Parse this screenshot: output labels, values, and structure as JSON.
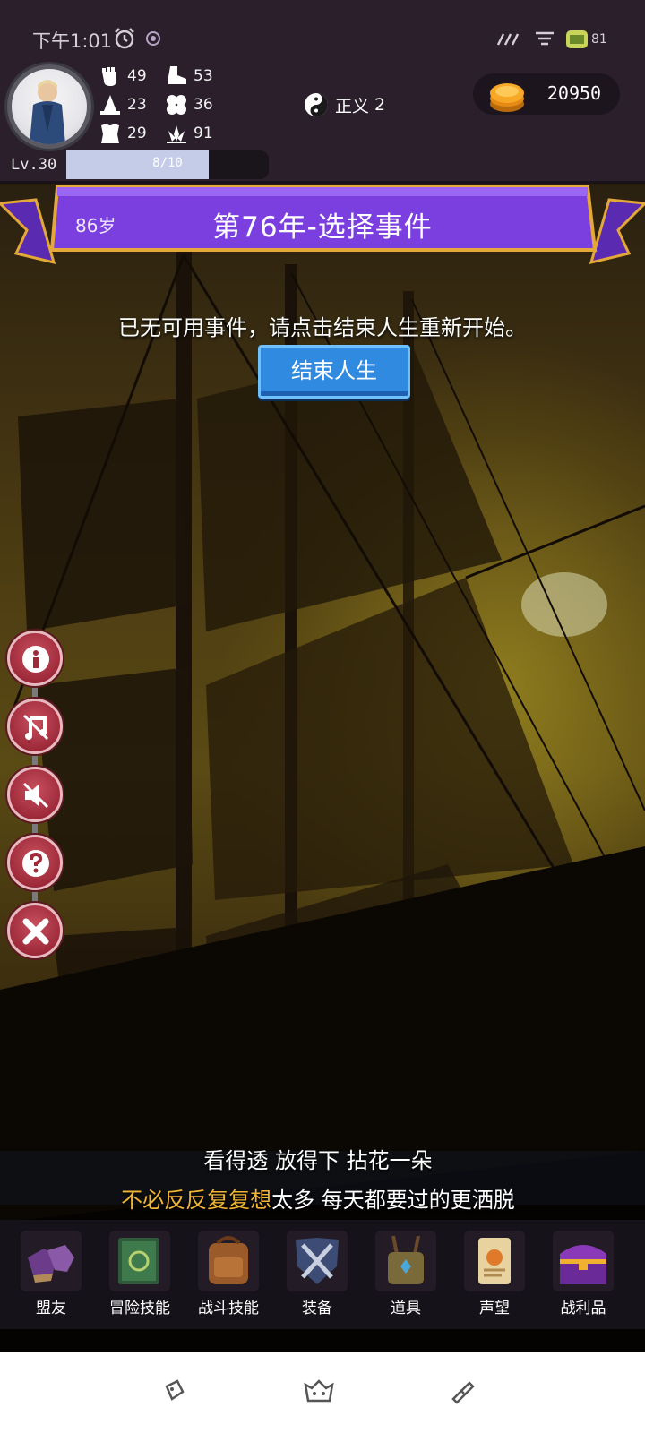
{
  "status_bar": {
    "time": "下午1:01",
    "battery": "81"
  },
  "player": {
    "stats": {
      "strength": "49",
      "agility": "53",
      "magic": "23",
      "luck": "36",
      "defense": "29",
      "spirit": "91"
    },
    "alignment": {
      "label": "正义",
      "value": "2"
    },
    "gold": "20950",
    "level": "Lv.30",
    "xp_text": "8/10",
    "xp_fraction": 0.8
  },
  "ribbon": {
    "age": "86岁",
    "title": "第76年-选择事件"
  },
  "message": "已无可用事件，请点击结束人生重新开始。",
  "end_button": "结束人生",
  "side_buttons": [
    "info-icon",
    "music-off-icon",
    "sound-off-icon",
    "help-icon",
    "close-icon"
  ],
  "lyrics": {
    "line1": "看得透 放得下 拈花一朵",
    "line2_highlight": "不必反反复复想",
    "line2_rest": "太多 每天都要过的更洒脱"
  },
  "menu": [
    {
      "label": "盟友",
      "icon": "gloves-icon"
    },
    {
      "label": "冒险技能",
      "icon": "spellbook-icon"
    },
    {
      "label": "战斗技能",
      "icon": "backpack-icon"
    },
    {
      "label": "装备",
      "icon": "crossed-swords-icon"
    },
    {
      "label": "道具",
      "icon": "satchel-icon"
    },
    {
      "label": "声望",
      "icon": "scroll-icon"
    },
    {
      "label": "战利品",
      "icon": "treasure-chest-icon"
    }
  ],
  "colors": {
    "ribbon": "#7b3fe0",
    "button": "#2f8ae0",
    "highlight": "#f3b534",
    "panel": "#2a1f2b"
  }
}
